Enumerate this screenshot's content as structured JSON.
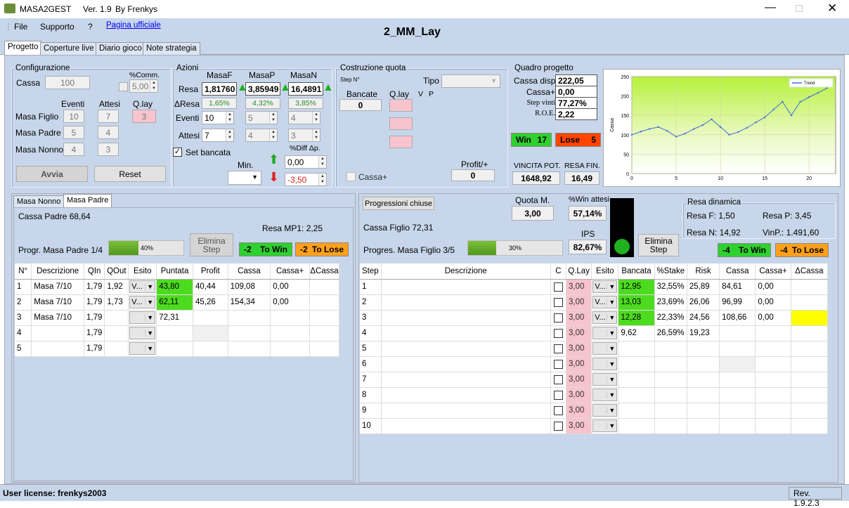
{
  "window": {
    "title": "MASA2GEST",
    "version": "Ver. 1.9",
    "by": "By  Frenkys"
  },
  "menu": {
    "file": "File",
    "support": "Supporto",
    "help": "?",
    "link": "Pagina ufficiale"
  },
  "project_title": "2_MM_Lay",
  "tabs": [
    "Progetto",
    "Coperture live",
    "Diario gioco",
    "Note strategia"
  ],
  "config": {
    "title": "Configurazione",
    "cassa_label": "Cassa",
    "cassa_value": "100",
    "comm_label": "%Comm.",
    "comm_value": "5,00",
    "eventi": "Eventi",
    "attesi": "Attesi",
    "qlay": "Q.lay",
    "rows": [
      {
        "label": "Masa Figlio",
        "eventi": "10",
        "attesi": "7",
        "qlay": "3"
      },
      {
        "label": "Masa Padre",
        "eventi": "5",
        "attesi": "4"
      },
      {
        "label": "Masa Nonno",
        "eventi": "4",
        "attesi": "3"
      }
    ],
    "avvia": "Avvia",
    "reset": "Reset"
  },
  "azioni": {
    "title": "Azioni",
    "masaf": "MasaF",
    "masap": "MasaP",
    "masan": "MasaN",
    "resa_label": "Resa",
    "resa": [
      "1,81760",
      "3,85949",
      "16,4891"
    ],
    "dresa_label": "ΔResa",
    "dresa": [
      "1,65%",
      "4,32%",
      "3,85%"
    ],
    "eventi_label": "Eventi",
    "eventi": [
      "10",
      "5",
      "4"
    ],
    "attesi_label": "Attesi",
    "attesi": [
      "7",
      "4",
      "3"
    ],
    "set_bancata": "Set bancata",
    "min_label": "Min.",
    "diff_label": "%Diff Δp.",
    "up_value": "0,00",
    "down_value": "-3,50"
  },
  "costruzione": {
    "title": "Costruzione quota",
    "step": "Step N°",
    "tipo": "Tipo",
    "bancate": "Bancate",
    "bancate_value": "0",
    "qlay": "Q.lay",
    "v": "V",
    "p": "P",
    "profit_label": "Profit/+",
    "profit_value": "0",
    "cassa_plus": "Cassa+"
  },
  "quadro": {
    "title": "Quadro progetto",
    "rows": [
      {
        "label": "Cassa disp.",
        "value": "222,05"
      },
      {
        "label": "Cassa+",
        "value": "0,00"
      },
      {
        "label": "Step vinti",
        "value": "77,27%"
      },
      {
        "label": "R.O.E.",
        "value": "2,22"
      }
    ],
    "win": "Win",
    "win_value": "17",
    "lose": "Lose",
    "lose_value": "5",
    "vincita_label": "VINCITA POT.",
    "vincita_value": "1648,92",
    "resa_fin_label": "RESA FIN.",
    "resa_fin_value": "16,49"
  },
  "chart_data": {
    "type": "line",
    "series": [
      {
        "name": "Trend",
        "x": [
          0,
          1,
          2,
          3,
          4,
          5,
          6,
          7,
          8,
          9,
          10,
          11,
          12,
          13,
          14,
          15,
          16,
          17,
          18,
          19,
          20,
          21,
          22
        ],
        "values": [
          100,
          108,
          115,
          120,
          110,
          95,
          103,
          115,
          125,
          140,
          120,
          100,
          107,
          118,
          132,
          145,
          165,
          185,
          150,
          185,
          197,
          208,
          220
        ]
      }
    ],
    "ylabel": "Cassa",
    "ylim": [
      0,
      250
    ],
    "xlim": [
      0,
      23
    ],
    "yticks": [
      "0",
      "50",
      "100",
      "150",
      "200",
      "250"
    ],
    "xticks": [
      "0",
      "5",
      "10",
      "15",
      "20"
    ],
    "legend": "top-right",
    "grid": true
  },
  "left_panel": {
    "tabs": [
      "Masa Nonno",
      "Masa Padre"
    ],
    "cassa": "Cassa Padre 68,64",
    "resa": "Resa MP1: 2,25",
    "elimina": "Elimina Step",
    "progr": "Progr. Masa Padre 1/4",
    "progress_pct": 40,
    "progress_label": "40%",
    "towin_n": "-2",
    "towin": "To Win",
    "tolose_n": "-2",
    "tolose": "To Lose",
    "headers": [
      "N°",
      "Descrizione",
      "QIn",
      "QOut",
      "Esito",
      "Puntata",
      "Profit",
      "Cassa",
      "Cassa+",
      "ΔCassa"
    ],
    "rows": [
      {
        "n": "1",
        "desc": "Masa 7/10",
        "qin": "1,79",
        "qout": "1,92",
        "esito": "V...",
        "puntata": "43,80",
        "profit": "40,44",
        "cassa": "109,08",
        "cassap": "0,00"
      },
      {
        "n": "2",
        "desc": "Masa 7/10",
        "qin": "1,79",
        "qout": "1,73",
        "esito": "V...",
        "puntata": "62,11",
        "profit": "45,26",
        "cassa": "154,34",
        "cassap": "0,00"
      },
      {
        "n": "3",
        "desc": "Masa 7/10",
        "qin": "1,79",
        "qout": "",
        "esito": "",
        "puntata": "72,31",
        "profit": "",
        "cassa": "",
        "cassap": ""
      },
      {
        "n": "4",
        "desc": "",
        "qin": "1,79",
        "qout": "",
        "esito": "",
        "puntata": "",
        "profit": "",
        "cassa": "",
        "cassap": ""
      },
      {
        "n": "5",
        "desc": "",
        "qin": "1,79",
        "qout": "",
        "esito": "",
        "puntata": "",
        "profit": "",
        "cassa": "",
        "cassap": ""
      }
    ]
  },
  "right_panel": {
    "prog_chiuse": "Progressioni chiuse",
    "quota_label": "Quota M.",
    "quota_value": "3,00",
    "win_attesi_label": "%Win attesi",
    "win_attesi_value": "57,14%",
    "ips_label": "IPS",
    "ips_value": "82,67%",
    "cassa": "Cassa Figlio 72,31",
    "progr": "Progres. Masa Figlio 3/5",
    "progress_pct": 30,
    "progress_label": "30%",
    "elimina": "Elimina Step",
    "resa_title": "Resa dinamica",
    "resa_f": "Resa F: 1,50",
    "resa_p": "Resa P: 3,45",
    "resa_n": "Resa N: 14,92",
    "vinp": "VinP.: 1.491,60",
    "towin_n": "-4",
    "towin": "To Win",
    "tolose_n": "-4",
    "tolose": "To Lose",
    "headers": [
      "Step",
      "Descrizione",
      "C",
      "Q.Lay",
      "Esito",
      "Bancata",
      "%Stake",
      "Risk",
      "Cassa",
      "Cassa+",
      "ΔCassa"
    ],
    "rows": [
      {
        "step": "1",
        "qlay": "3,00",
        "esito": "V...",
        "bancata": "12,95",
        "stake": "32,55%",
        "risk": "25,89",
        "cassa": "84,61",
        "cassap": "0,00"
      },
      {
        "step": "2",
        "qlay": "3,00",
        "esito": "V...",
        "bancata": "13,03",
        "stake": "23,69%",
        "risk": "26,06",
        "cassa": "96,99",
        "cassap": "0,00"
      },
      {
        "step": "3",
        "qlay": "3,00",
        "esito": "V...",
        "bancata": "12,28",
        "stake": "22,33%",
        "risk": "24,56",
        "cassa": "108,66",
        "cassap": "0,00"
      },
      {
        "step": "4",
        "qlay": "3,00",
        "esito": "",
        "bancata": "9,62",
        "stake": "26,59%",
        "risk": "19,23",
        "cassa": "",
        "cassap": ""
      },
      {
        "step": "5",
        "qlay": "3,00",
        "esito": "",
        "bancata": "",
        "stake": "",
        "risk": "",
        "cassa": "",
        "cassap": ""
      },
      {
        "step": "6",
        "qlay": "3,00",
        "esito": "",
        "bancata": "",
        "stake": "",
        "risk": "",
        "cassa": "",
        "cassap": ""
      },
      {
        "step": "7",
        "qlay": "3,00",
        "esito": "",
        "bancata": "",
        "stake": "",
        "risk": "",
        "cassa": "",
        "cassap": ""
      },
      {
        "step": "8",
        "qlay": "3,00",
        "esito": "",
        "bancata": "",
        "stake": "",
        "risk": "",
        "cassa": "",
        "cassap": ""
      },
      {
        "step": "9",
        "qlay": "3,00",
        "esito": "",
        "bancata": "",
        "stake": "",
        "risk": "",
        "cassa": "",
        "cassap": ""
      },
      {
        "step": "10",
        "qlay": "3,00",
        "esito": "",
        "bancata": "",
        "stake": "",
        "risk": "",
        "cassa": "",
        "cassap": ""
      }
    ]
  },
  "status": {
    "license": "User license: frenkys2003",
    "rev": "Rev. 1.9.2.3"
  },
  "colors": {
    "panel": "#c7d6ea",
    "green": "#4ddb1f",
    "pink": "#f7c3cc",
    "orange": "#ffa01c",
    "red": "#ff4500",
    "yellow": "#ffff00"
  }
}
